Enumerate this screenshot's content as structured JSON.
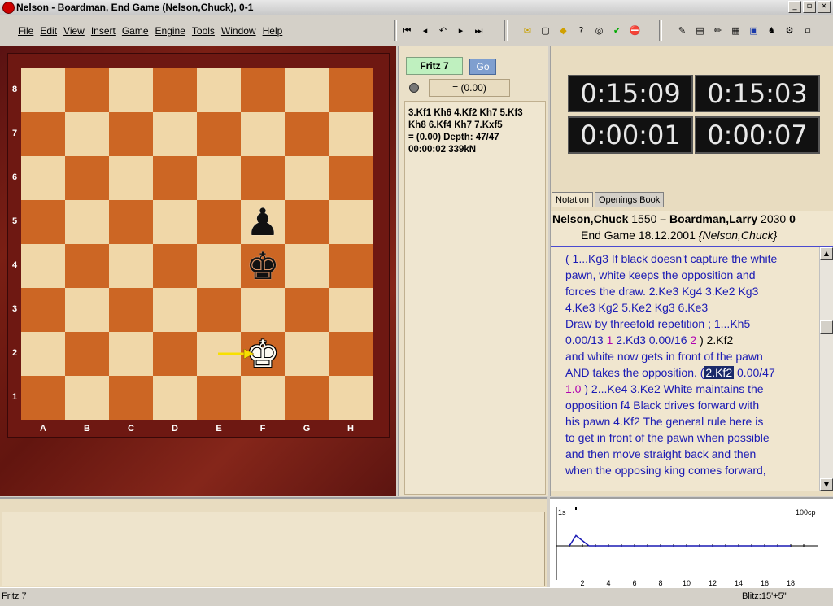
{
  "window": {
    "title": "Nelson - Boardman, End Game  (Nelson,Chuck), 0-1",
    "controls": [
      "_",
      "▫",
      "×"
    ]
  },
  "menu": [
    "File",
    "Edit",
    "View",
    "Insert",
    "Game",
    "Engine",
    "Tools",
    "Window",
    "Help"
  ],
  "toolbar": {
    "nav": [
      "⏮",
      "◂",
      "↶",
      "▸",
      "⏭"
    ],
    "actions": [
      "✉",
      "▢",
      "◆",
      "?",
      "◎",
      "✔",
      "⛔"
    ],
    "tools": [
      "✎",
      "▤",
      "✏",
      "▦",
      "▣",
      "♞",
      "⚙",
      "⧉"
    ]
  },
  "board": {
    "ranks": [
      "8",
      "7",
      "6",
      "5",
      "4",
      "3",
      "2",
      "1"
    ],
    "files": [
      "A",
      "B",
      "C",
      "D",
      "E",
      "F",
      "G",
      "H"
    ],
    "pieces": [
      {
        "name": "black-pawn",
        "glyph": "♟",
        "square": "f5",
        "color": "black"
      },
      {
        "name": "black-king",
        "glyph": "♚",
        "square": "f4",
        "color": "black"
      },
      {
        "name": "white-king",
        "glyph": "♚",
        "square": "f2",
        "color": "white"
      }
    ],
    "colors": {
      "light": "#f0d7a8",
      "dark": "#cc6624"
    }
  },
  "engine": {
    "name": "Fritz 7",
    "go_label": "Go",
    "eval": "= (0.00)",
    "lines": [
      "3.Kf1 Kh6 4.Kf2 Kh7 5.Kf3",
      "Kh8 6.Kf4 Kh7 7.Kxf5",
      "=  (0.00)    Depth:  47/47",
      "00:00:02  339kN"
    ]
  },
  "clocks": {
    "white_total": "0:15:09",
    "black_total": "0:15:03",
    "white_move": "0:00:01",
    "black_move": "0:00:07"
  },
  "tabs": [
    "Notation",
    "Openings Book"
  ],
  "game_header": {
    "white": "Nelson,Chuck",
    "white_elo": "1550",
    "dash": " – ",
    "black": "Boardman,Larry",
    "black_elo": "2030",
    "result": "0",
    "event": "End Game 18.12.2001",
    "annotator": "{Nelson,Chuck}"
  },
  "notation": [
    [
      {
        "t": "( 1...Kg3 If black doesn't capture the white",
        "c": "blue"
      }
    ],
    [
      {
        "t": "pawn,  white keeps the opposition and",
        "c": "blue"
      }
    ],
    [
      {
        "t": "forces the draw.  2.Ke3  Kg4  3.Ke2  Kg3",
        "c": "blue"
      }
    ],
    [
      {
        "t": "4.Ke3  Kg2  5.Ke2  Kg3  6.Ke3",
        "c": "blue"
      }
    ],
    [
      {
        "t": "Draw by threefold repetition ; 1...Kh5",
        "c": "blue"
      }
    ],
    [
      {
        "t": "0.00/13",
        "c": "blue"
      },
      {
        "t": "   1  ",
        "c": "mag"
      },
      {
        "t": "2.Kd3  0.00/16",
        "c": "blue"
      },
      {
        "t": "  2 ",
        "c": "mag"
      },
      {
        "t": ") 2.Kf2",
        "c": "black"
      }
    ],
    [
      {
        "t": "and white now gets in front of the pawn",
        "c": "blue"
      }
    ],
    [
      {
        "t": "AND takes the opposition.  (",
        "c": "blue"
      },
      {
        "t": "2.Kf2",
        "c": "hl"
      },
      {
        "t": " 0.00/47",
        "c": "blue"
      }
    ],
    [
      {
        "t": "1.0",
        "c": "mag"
      },
      {
        "t": "  ) 2...Ke4  3.Ke2 White maintains the",
        "c": "blue"
      }
    ],
    [
      {
        "t": "opposition  f4 Black drives forward with",
        "c": "blue"
      }
    ],
    [
      {
        "t": "his pawn  4.Kf2 The general rule here is",
        "c": "blue"
      }
    ],
    [
      {
        "t": "to get in front of the pawn when possible",
        "c": "blue"
      }
    ],
    [
      {
        "t": "and then move straight back and then",
        "c": "blue"
      }
    ],
    [
      {
        "t": "when the opposing king comes forward,",
        "c": "blue"
      }
    ]
  ],
  "graph": {
    "left_label": "1s",
    "right_label": "100cp",
    "x_ticks": [
      "2",
      "4",
      "6",
      "8",
      "10",
      "12",
      "14",
      "16",
      "18"
    ],
    "points": [
      {
        "move": 1,
        "value": 0
      },
      {
        "move": 1.5,
        "value": 0.35
      },
      {
        "move": 2.5,
        "value": 0
      },
      {
        "move": 18,
        "value": 0
      }
    ],
    "line_color": "#1a1ab4"
  },
  "status": {
    "left": "Fritz 7",
    "right": "Blitz:15'+5\""
  }
}
